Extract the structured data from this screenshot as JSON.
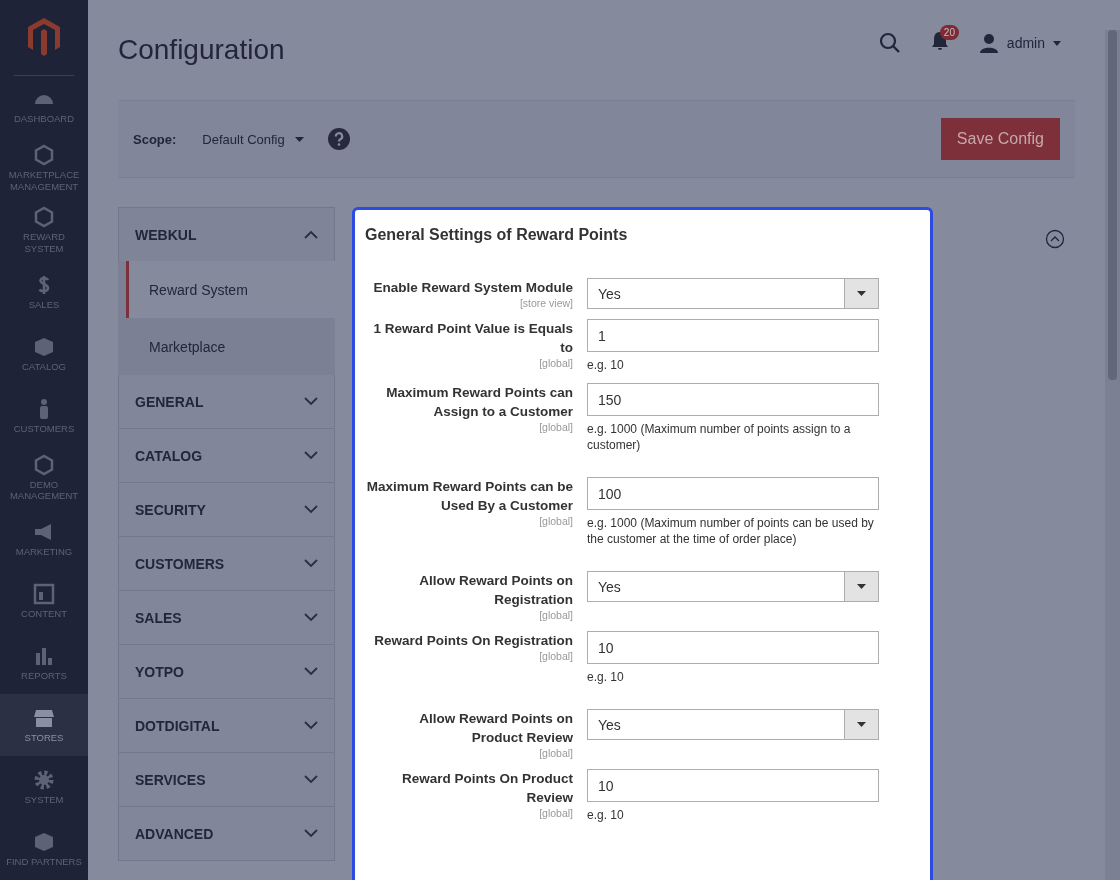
{
  "nav": {
    "items": [
      {
        "label": "DASHBOARD",
        "selected": false
      },
      {
        "label": "MARKETPLACE MANAGEMENT",
        "selected": false
      },
      {
        "label": "REWARD SYSTEM",
        "selected": false
      },
      {
        "label": "SALES",
        "selected": false
      },
      {
        "label": "CATALOG",
        "selected": false
      },
      {
        "label": "CUSTOMERS",
        "selected": false
      },
      {
        "label": "DEMO MANAGEMENT",
        "selected": false
      },
      {
        "label": "MARKETING",
        "selected": false
      },
      {
        "label": "CONTENT",
        "selected": false
      },
      {
        "label": "REPORTS",
        "selected": false
      },
      {
        "label": "STORES",
        "selected": true
      },
      {
        "label": "SYSTEM",
        "selected": false
      },
      {
        "label": "FIND PARTNERS",
        "selected": false
      }
    ]
  },
  "header": {
    "title": "Configuration",
    "notification_count": "20",
    "user": "admin"
  },
  "scope_bar": {
    "label": "Scope:",
    "value": "Default Config",
    "save_button": "Save Config"
  },
  "config_tabs": [
    {
      "label": "WEBKUL",
      "expanded": true,
      "children": [
        {
          "label": "Reward System",
          "selected": true
        },
        {
          "label": "Marketplace",
          "selected": false
        }
      ]
    },
    {
      "label": "GENERAL",
      "expanded": false
    },
    {
      "label": "CATALOG",
      "expanded": false
    },
    {
      "label": "SECURITY",
      "expanded": false
    },
    {
      "label": "CUSTOMERS",
      "expanded": false
    },
    {
      "label": "SALES",
      "expanded": false
    },
    {
      "label": "YOTPO",
      "expanded": false
    },
    {
      "label": "DOTDIGITAL",
      "expanded": false
    },
    {
      "label": "SERVICES",
      "expanded": false
    },
    {
      "label": "ADVANCED",
      "expanded": false
    }
  ],
  "section": {
    "title": "General Settings of Reward Points",
    "expanded": true,
    "fields": [
      {
        "kind": "select",
        "label": "Enable Reward System Module",
        "scope": "[store view]",
        "value": "Yes"
      },
      {
        "kind": "text",
        "label": "1 Reward Point Value is Equals to",
        "scope": "[global]",
        "value": "1",
        "note": "e.g. 10"
      },
      {
        "kind": "text",
        "label": "Maximum Reward Points can Assign to a Customer",
        "scope": "[global]",
        "value": "150",
        "note": "e.g. 1000 (Maximum number of points assign to a customer)"
      },
      {
        "kind": "text",
        "label": "Maximum Reward Points can be Used By a Customer",
        "scope": "[global]",
        "value": "100",
        "note": "e.g. 1000 (Maximum number of points can be used by the customer at the time of order place)"
      },
      {
        "kind": "select",
        "label": "Allow Reward Points on Registration",
        "scope": "[global]",
        "value": "Yes"
      },
      {
        "kind": "text",
        "label": "Reward Points On Registration",
        "scope": "[global]",
        "value": "10",
        "note": "e.g. 10"
      },
      {
        "kind": "select",
        "label": "Allow Reward Points on Product Review",
        "scope": "[global]",
        "value": "Yes"
      },
      {
        "kind": "text",
        "label": "Reward Points On Product Review",
        "scope": "[global]",
        "value": "10",
        "note": "e.g. 10"
      }
    ]
  }
}
